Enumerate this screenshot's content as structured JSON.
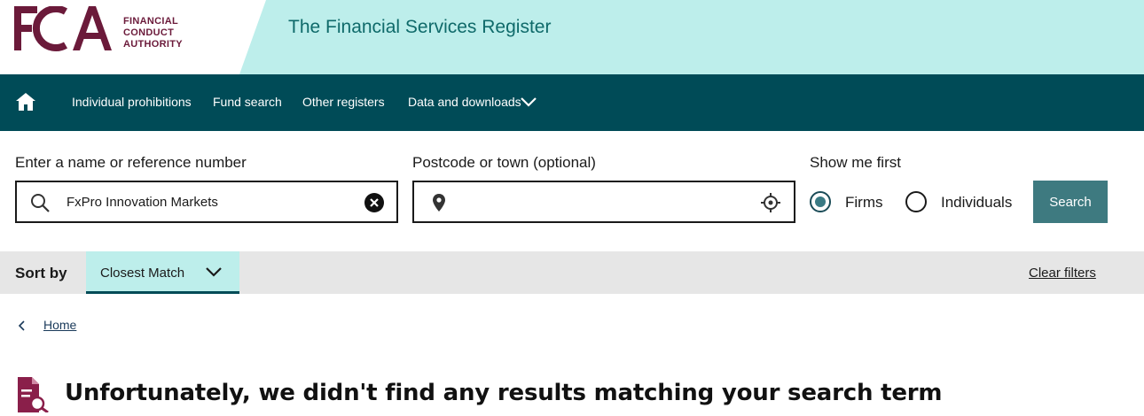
{
  "header": {
    "logo_mark": "FCA",
    "logo_lines": [
      "FINANCIAL",
      "CONDUCT",
      "AUTHORITY"
    ],
    "title": "The Financial Services Register",
    "band_color": "#bdeeeb",
    "brand_color": "#6b1a3a"
  },
  "nav": {
    "home_icon": "home-icon",
    "items": [
      {
        "label": "Individual prohibitions"
      },
      {
        "label": "Fund search"
      },
      {
        "label": "Other registers"
      },
      {
        "label": "Data and downloads"
      }
    ],
    "background": "#004b57"
  },
  "search": {
    "name_label": "Enter a name or reference number",
    "name_value": "FxPro Innovation Markets",
    "postcode_label": "Postcode or town (optional)",
    "postcode_value": "",
    "show_first_label": "Show me first",
    "options": [
      {
        "label": "Firms",
        "checked": true
      },
      {
        "label": "Individuals",
        "checked": false
      }
    ],
    "button_label": "Search"
  },
  "sort": {
    "label": "Sort by",
    "selected": "Closest Match",
    "clear_label": "Clear filters"
  },
  "breadcrumb": {
    "home_label": "Home"
  },
  "results": {
    "message": "Unfortunately, we didn't find any results matching your search term"
  }
}
